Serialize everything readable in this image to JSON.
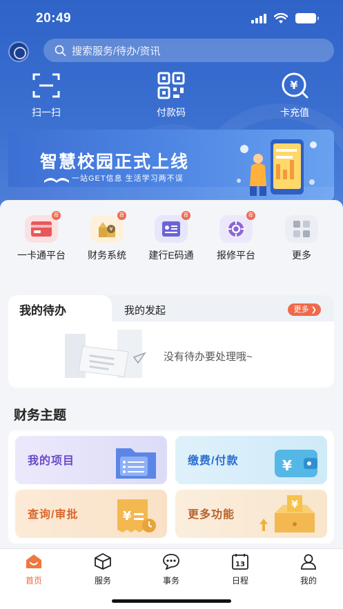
{
  "status_bar": {
    "time": "20:49"
  },
  "search": {
    "placeholder": "搜索服务/待办/资讯"
  },
  "quick_actions": [
    {
      "label": "扫一扫",
      "icon": "scan-icon"
    },
    {
      "label": "付款码",
      "icon": "qr-code-icon"
    },
    {
      "label": "卡充值",
      "icon": "yen-recharge-icon"
    }
  ],
  "banner": {
    "title": "智慧校园正式上线",
    "subtitle": "一站GET信息 生活学习两不误"
  },
  "services": [
    {
      "label": "一卡通平台",
      "icon": "card-icon",
      "badge": "荐",
      "color": "#fbe1e1",
      "icon_color": "#e8585a"
    },
    {
      "label": "财务系统",
      "icon": "finance-icon",
      "badge": "荐",
      "color": "#fdf1dc",
      "icon_color": "#d9a640"
    },
    {
      "label": "建行E码通",
      "icon": "e-code-icon",
      "badge": "荐",
      "color": "#e7e6fb",
      "icon_color": "#6b63d8"
    },
    {
      "label": "报修平台",
      "icon": "repair-icon",
      "badge": "荐",
      "color": "#ece8fb",
      "icon_color": "#8a66d8"
    },
    {
      "label": "更多",
      "icon": "grid-more-icon",
      "badge": "",
      "color": "#eceef3",
      "icon_color": "#a7adba"
    }
  ],
  "todo": {
    "tab_active": "我的待办",
    "tab_other": "我的发起",
    "more_label": "更多",
    "empty_text": "没有待办要处理哦~"
  },
  "finance": {
    "section_title": "财务主题",
    "cards": [
      {
        "label": "我的项目",
        "icon": "folder-icon",
        "text_color": "#6a49c8"
      },
      {
        "label": "缴费/付款",
        "icon": "wallet-icon",
        "text_color": "#2a6fd1"
      },
      {
        "label": "查询/审批",
        "icon": "receipt-icon",
        "text_color": "#d9662b"
      },
      {
        "label": "更多功能",
        "icon": "box-icon",
        "text_color": "#b8622a"
      }
    ]
  },
  "tabbar": [
    {
      "label": "首页",
      "icon": "home-icon",
      "active": true
    },
    {
      "label": "服务",
      "icon": "cube-icon",
      "active": false
    },
    {
      "label": "事务",
      "icon": "chat-icon",
      "active": false
    },
    {
      "label": "日程",
      "icon": "calendar-icon",
      "active": false
    },
    {
      "label": "我的",
      "icon": "user-icon",
      "active": false
    }
  ],
  "colors": {
    "primary_blue": "#3366cc",
    "accent_orange": "#ef6a4b"
  }
}
